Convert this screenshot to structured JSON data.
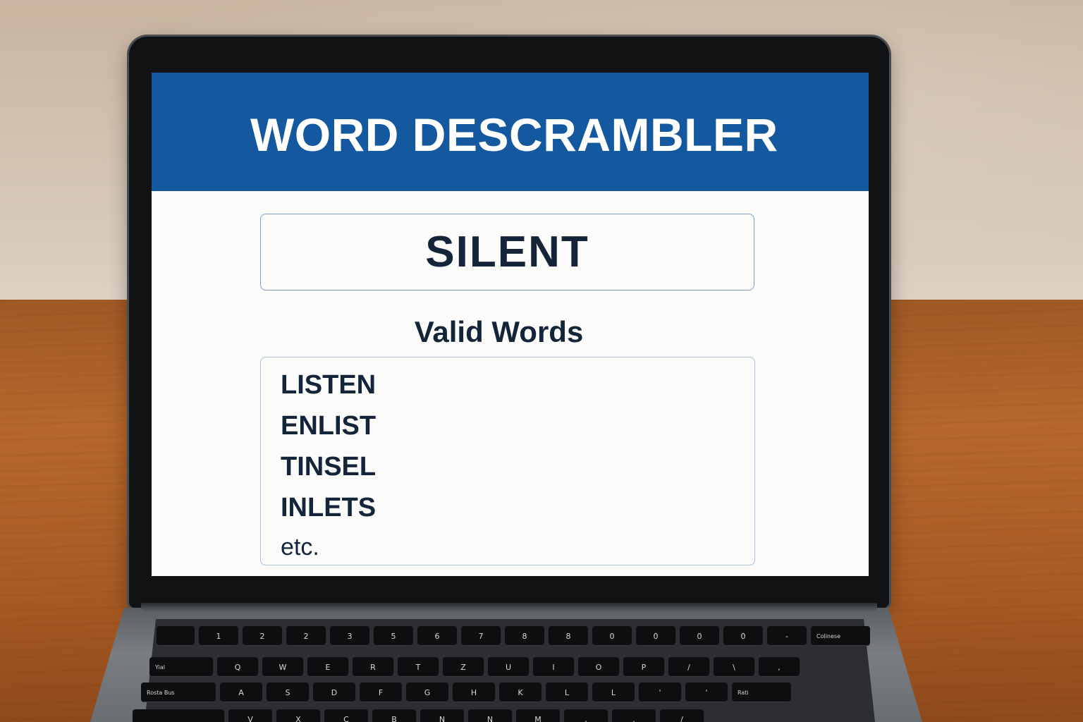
{
  "app": {
    "title": "WORD DESCRAMBLER",
    "header_color": "#1458a0"
  },
  "input": {
    "value": "SILENT"
  },
  "results": {
    "heading": "Valid Words",
    "words": [
      "LISTEN",
      "ENLIST",
      "TINSEL",
      "INLETS"
    ],
    "more": "etc."
  },
  "keyboard": {
    "row1": [
      "",
      "$",
      "&",
      "$",
      "$",
      "&",
      "$",
      "%",
      "&",
      "",
      "",
      "",
      "",
      "'",
      "<",
      ""
    ],
    "row1_sub": [
      "1",
      "2",
      "2",
      "3",
      "5",
      "6",
      "7",
      "8",
      "8",
      "0",
      "0",
      "0",
      "0",
      "-",
      "-",
      "Colinese"
    ],
    "row2": [
      "Yial",
      "Q",
      "W",
      "E",
      "R",
      "T",
      "Z",
      "U",
      "I",
      "O",
      "P",
      "/",
      "\\",
      ","
    ],
    "row3": [
      "Rosta Bus",
      "A",
      "S",
      "D",
      "F",
      "G",
      "H",
      "K",
      "L",
      "L",
      "'",
      "'",
      "Rati"
    ],
    "row4": [
      "",
      "V",
      "X",
      "C",
      "B",
      "N",
      "N",
      "M",
      ",",
      ".",
      "/",
      ""
    ]
  }
}
